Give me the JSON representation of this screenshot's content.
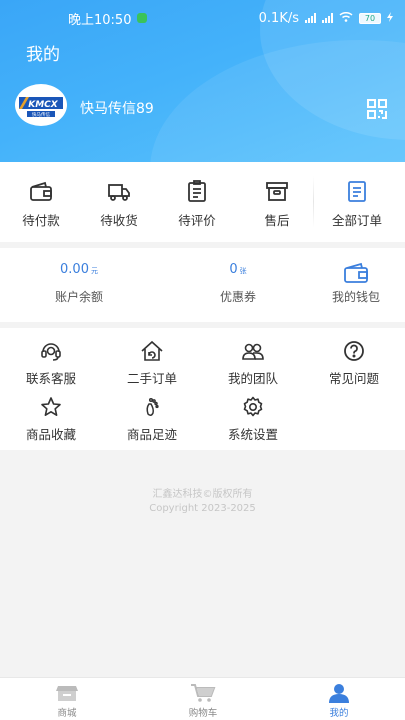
{
  "status_bar": {
    "time": "晚上10:50",
    "speed": "0.1K/s",
    "battery": "70"
  },
  "header": {
    "title": "我的",
    "avatar_logo_text": "KMCX",
    "avatar_logo_subtext": "快马传信",
    "username": "快马传信89",
    "qr_icon": "qr-code-icon"
  },
  "orders": {
    "items": [
      {
        "label": "待付款",
        "icon": "wallet-icon"
      },
      {
        "label": "待收货",
        "icon": "truck-icon"
      },
      {
        "label": "待评价",
        "icon": "clipboard-icon"
      },
      {
        "label": "售后",
        "icon": "box-icon"
      }
    ],
    "all_label": "全部订单",
    "all_icon": "document-icon"
  },
  "wallet": {
    "balance_value": "0.00",
    "balance_unit": "元",
    "balance_label": "账户余额",
    "coupon_value": "0",
    "coupon_unit": "张",
    "coupon_label": "优惠券",
    "wallet_label": "我的钱包"
  },
  "tools": [
    {
      "label": "联系客服",
      "icon": "headset-icon"
    },
    {
      "label": "二手订单",
      "icon": "home-refresh-icon"
    },
    {
      "label": "我的团队",
      "icon": "team-icon"
    },
    {
      "label": "常见问题",
      "icon": "question-icon"
    },
    {
      "label": "商品收藏",
      "icon": "star-icon"
    },
    {
      "label": "商品足迹",
      "icon": "footprint-icon"
    },
    {
      "label": "系统设置",
      "icon": "gear-icon"
    }
  ],
  "copyright": {
    "line1": "汇鑫达科技©版权所有",
    "line2": "Copyright 2023-2025"
  },
  "tabbar": [
    {
      "label": "商城",
      "icon": "shop-icon"
    },
    {
      "label": "购物车",
      "icon": "cart-icon"
    },
    {
      "label": "我的",
      "icon": "user-icon"
    }
  ],
  "colors": {
    "header_blue": "#44b2fa",
    "accent_blue": "#3b7fdd",
    "icon_dark": "#333333"
  }
}
